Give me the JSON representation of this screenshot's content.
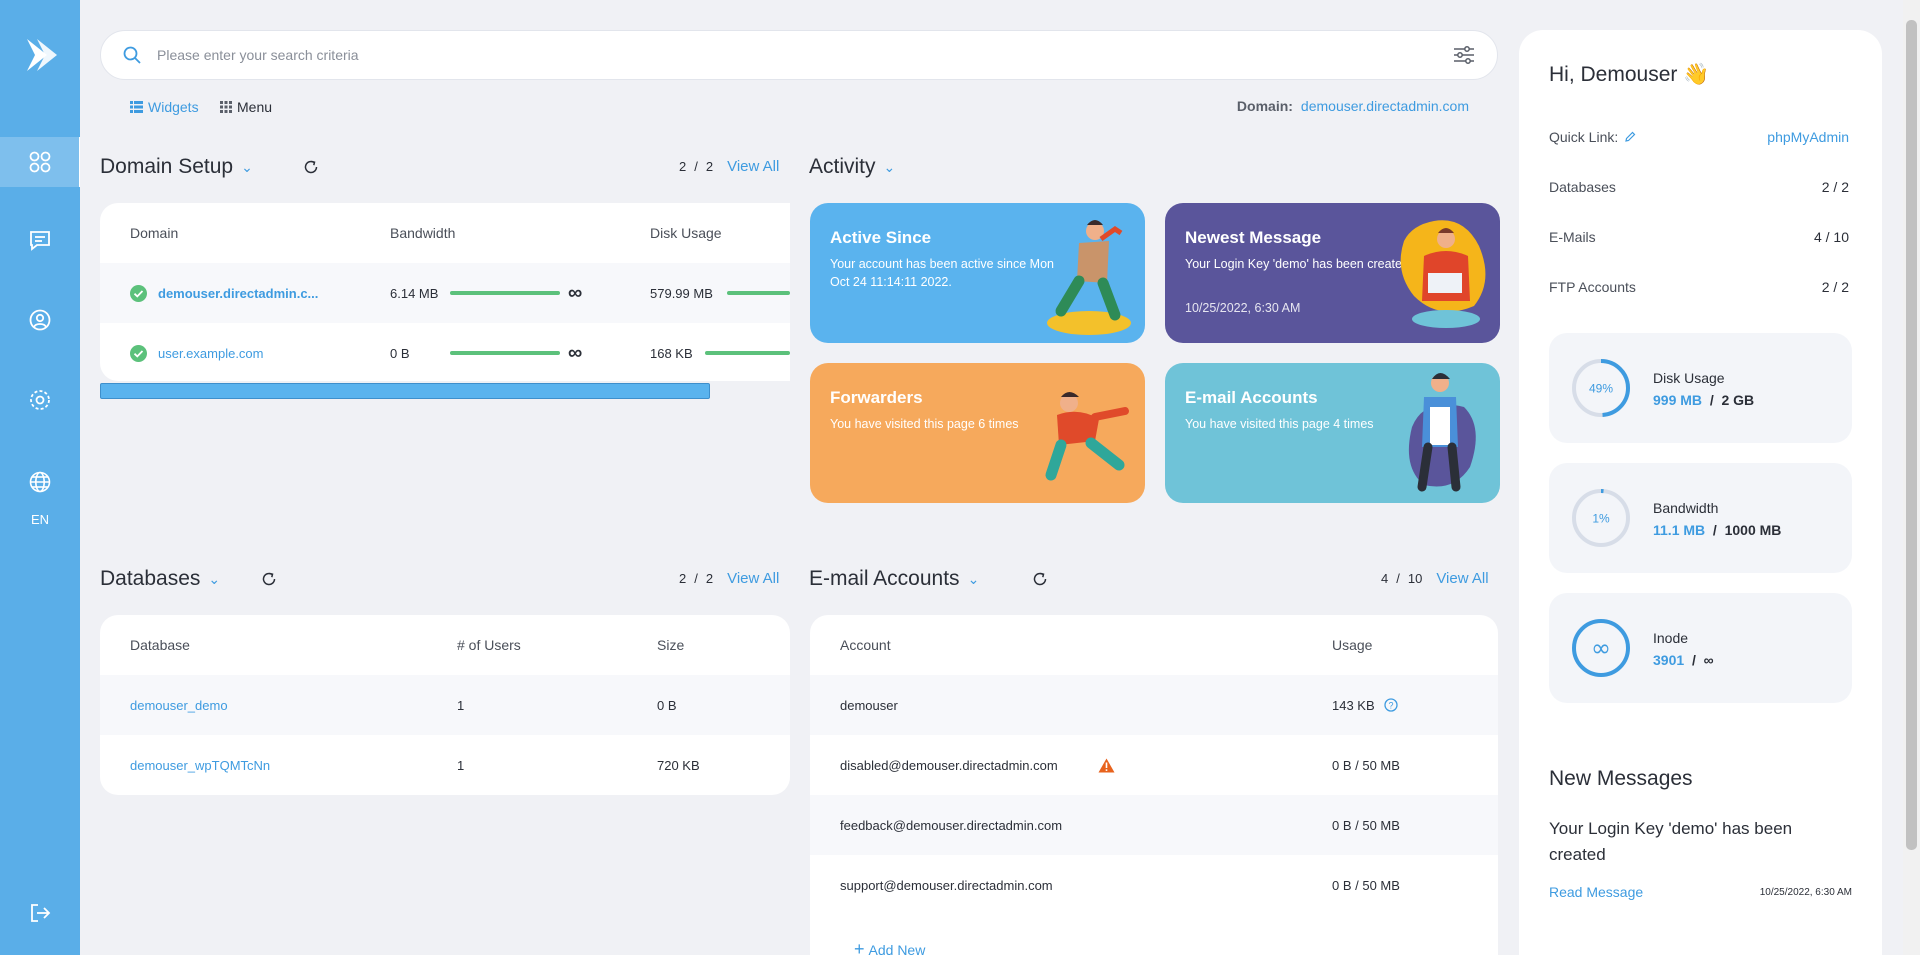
{
  "sidebar": {
    "lang": "EN",
    "items": [
      "dashboard-icon",
      "message-icon",
      "user-icon",
      "settings-icon",
      "globe-icon",
      "logout-icon"
    ]
  },
  "search": {
    "placeholder": "Please enter your search criteria"
  },
  "view": {
    "widgets": "Widgets",
    "menu": "Menu"
  },
  "domain": {
    "label": "Domain:",
    "value": "demouser.directadmin.com"
  },
  "domain_setup": {
    "title": "Domain Setup",
    "count": "2",
    "slash": "/",
    "total": "2",
    "view_all": "View All",
    "headers": {
      "domain": "Domain",
      "bandwidth": "Bandwidth",
      "disk": "Disk Usage"
    },
    "rows": [
      {
        "domain": "demouser.directadmin.c...",
        "bandwidth": "6.14 MB",
        "disk": "579.99 MB"
      },
      {
        "domain": "user.example.com",
        "bandwidth": "0 B",
        "disk": "168 KB"
      }
    ]
  },
  "activity": {
    "title": "Activity",
    "cards": [
      {
        "title": "Active Since",
        "text": "Your account has been active since Mon Oct 24 11:14:11 2022.",
        "color": "#5ab3ee"
      },
      {
        "title": "Newest Message",
        "text": "Your Login Key 'demo' has been created",
        "date": "10/25/2022, 6:30 AM",
        "color": "#5a559b"
      },
      {
        "title": "Forwarders",
        "text": "You have visited this page 6 times",
        "color": "#f6a95c"
      },
      {
        "title": "E-mail Accounts",
        "text": "You have visited this page 4 times",
        "color": "#6fc3d8"
      }
    ]
  },
  "databases": {
    "title": "Databases",
    "count": "2",
    "slash": "/",
    "total": "2",
    "view_all": "View All",
    "headers": {
      "db": "Database",
      "users": "# of Users",
      "size": "Size"
    },
    "rows": [
      {
        "db": "demouser_demo",
        "users": "1",
        "size": "0 B"
      },
      {
        "db": "demouser_wpTQMTcNn",
        "users": "1",
        "size": "720 KB"
      }
    ]
  },
  "email": {
    "title": "E-mail Accounts",
    "count": "4",
    "slash": "/",
    "total": "10",
    "view_all": "View All",
    "headers": {
      "account": "Account",
      "usage": "Usage"
    },
    "rows": [
      {
        "account": "demouser",
        "usage": "143 KB"
      },
      {
        "account": "disabled@demouser.directadmin.com",
        "usage": "0 B / 50 MB"
      },
      {
        "account": "feedback@demouser.directadmin.com",
        "usage": "0 B / 50 MB"
      },
      {
        "account": "support@demouser.directadmin.com",
        "usage": "0 B / 50 MB"
      }
    ],
    "add_new": "Add New"
  },
  "right": {
    "greeting": "Hi, Demouser 👋",
    "quick_link_label": "Quick Link:",
    "quick_link_value": "phpMyAdmin",
    "stats": [
      {
        "label": "Databases",
        "value": "2 / 2"
      },
      {
        "label": "E-Mails",
        "value": "4 / 10"
      },
      {
        "label": "FTP Accounts",
        "value": "2 / 2"
      }
    ],
    "disk": {
      "label": "Disk Usage",
      "pct": "49%",
      "fraction": 0.49,
      "used": "999 MB",
      "slash": "/",
      "total": "2 GB"
    },
    "bandwidth": {
      "label": "Bandwidth",
      "pct": "1%",
      "fraction": 0.01,
      "used": "11.1 MB",
      "slash": "/",
      "total": "1000 MB"
    },
    "inode": {
      "label": "Inode",
      "used": "3901",
      "slash": "/",
      "total": "∞"
    },
    "new_messages_title": "New Messages",
    "message_text": "Your Login Key 'demo' has been created",
    "read_message": "Read Message",
    "message_date": "10/25/2022, 6:30 AM"
  }
}
